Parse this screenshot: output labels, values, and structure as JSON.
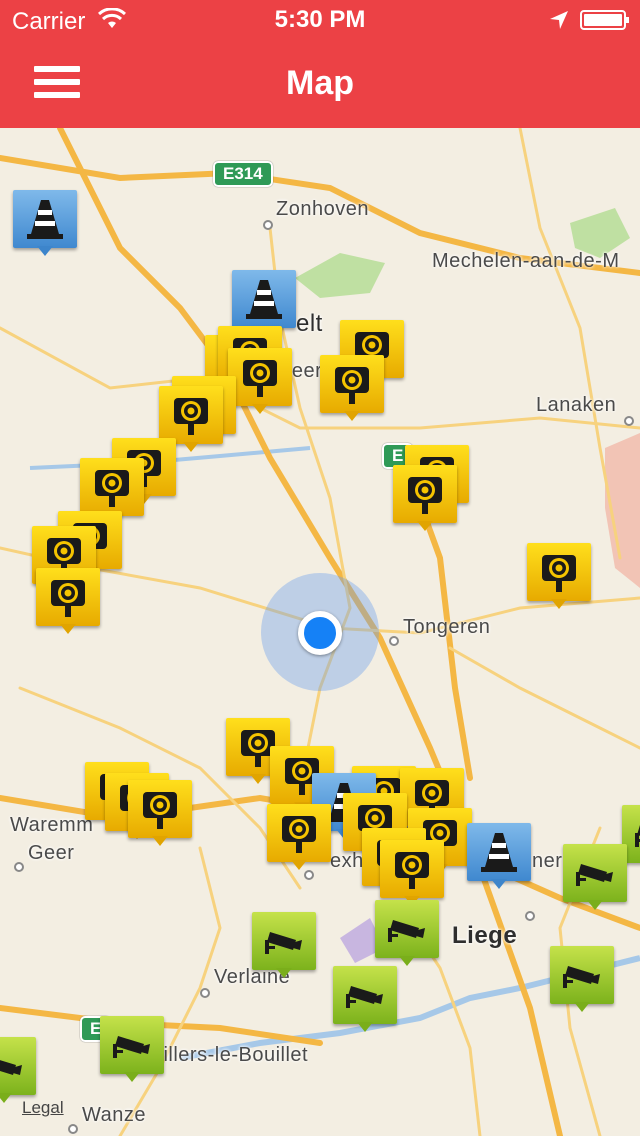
{
  "status_bar": {
    "carrier": "Carrier",
    "time": "5:30 PM"
  },
  "nav_bar": {
    "title": "Map",
    "menu_icon": "hamburger-menu-icon",
    "color": "#ec4145"
  },
  "map": {
    "places": [
      "Zonhoven",
      "Mechelen-aan-de-M",
      "elt",
      "Beer",
      "Lanaken",
      "Tongeren",
      "Waremm",
      "Geer",
      "exh",
      "Liege",
      "Verlaine",
      "Villers-le-Bouillet",
      "Wanze",
      "ner"
    ],
    "highway_shields": [
      "E314",
      "E",
      "E"
    ],
    "legal_link": "Legal",
    "marker_types": {
      "speed": {
        "icon": "speed-camera-icon",
        "color": "#f5c400"
      },
      "cone": {
        "icon": "traffic-cone-icon",
        "color": "#5aa0de"
      },
      "cctv": {
        "icon": "cctv-camera-icon",
        "color": "#9ccc2c"
      }
    }
  }
}
